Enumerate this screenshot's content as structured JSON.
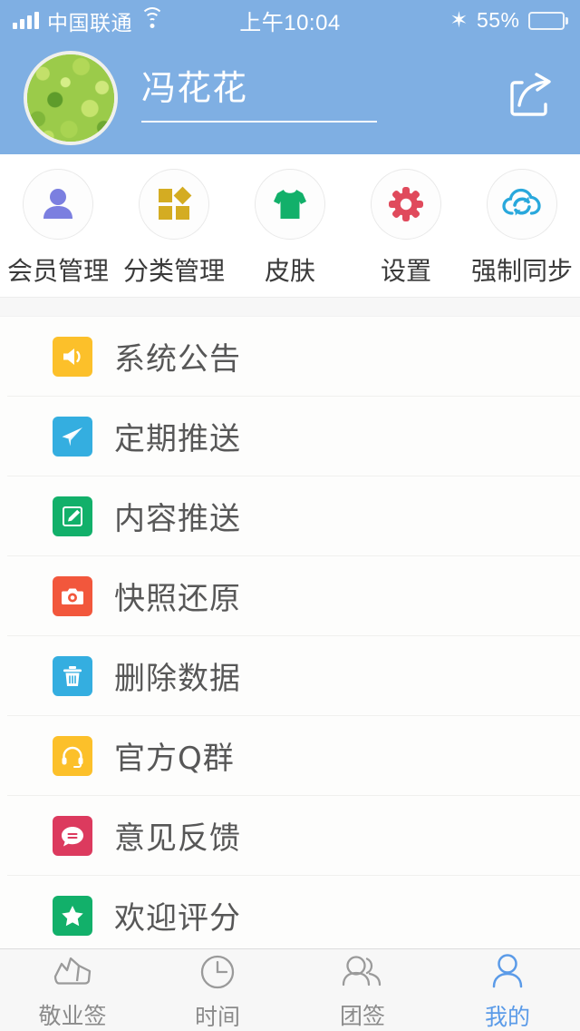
{
  "status_bar": {
    "carrier": "中国联通",
    "time": "上午10:04",
    "battery_percent": "55%",
    "battery_level": 55,
    "icons": [
      "signal-icon",
      "wifi-icon",
      "bluetooth-icon",
      "battery-icon"
    ]
  },
  "header": {
    "background_color": "#7FAFE3",
    "user_name": "冯花花",
    "avatar_name": "user-avatar",
    "share_label": "share-icon"
  },
  "quick_actions": [
    {
      "label": "会员管理",
      "icon": "person-icon",
      "color": "#7B7FE0"
    },
    {
      "label": "分类管理",
      "icon": "grid-icon",
      "color": "#D4AC22"
    },
    {
      "label": "皮肤",
      "icon": "tshirt-icon",
      "color": "#12B06A"
    },
    {
      "label": "设置",
      "icon": "gear-icon",
      "color": "#E04A5C"
    },
    {
      "label": "强制同步",
      "icon": "cloud-sync-icon",
      "color": "#29A8DC"
    }
  ],
  "menu_items": [
    {
      "label": "系统公告",
      "icon": "speaker-icon",
      "color": "#FCC02A"
    },
    {
      "label": "定期推送",
      "icon": "paper-plane-icon",
      "color": "#34AEE0"
    },
    {
      "label": "内容推送",
      "icon": "edit-square-icon",
      "color": "#12B06A"
    },
    {
      "label": "快照还原",
      "icon": "camera-icon",
      "color": "#F2573C"
    },
    {
      "label": "删除数据",
      "icon": "trash-icon",
      "color": "#34AEE0"
    },
    {
      "label": "官方Q群",
      "icon": "headset-icon",
      "color": "#FCC02A"
    },
    {
      "label": "意见反馈",
      "icon": "chat-bubble-icon",
      "color": "#DC3A5E"
    },
    {
      "label": "欢迎评分",
      "icon": "star-icon",
      "color": "#12B06A"
    }
  ],
  "tab_bar": {
    "active_color": "#5B9BE8",
    "inactive_color": "#8b8b8b",
    "tabs": [
      {
        "label": "敬业签",
        "icon": "note-fold-icon",
        "active": false
      },
      {
        "label": "时间",
        "icon": "clock-icon",
        "active": false
      },
      {
        "label": "团签",
        "icon": "group-icon",
        "active": false
      },
      {
        "label": "我的",
        "icon": "person-icon",
        "active": true
      }
    ]
  }
}
